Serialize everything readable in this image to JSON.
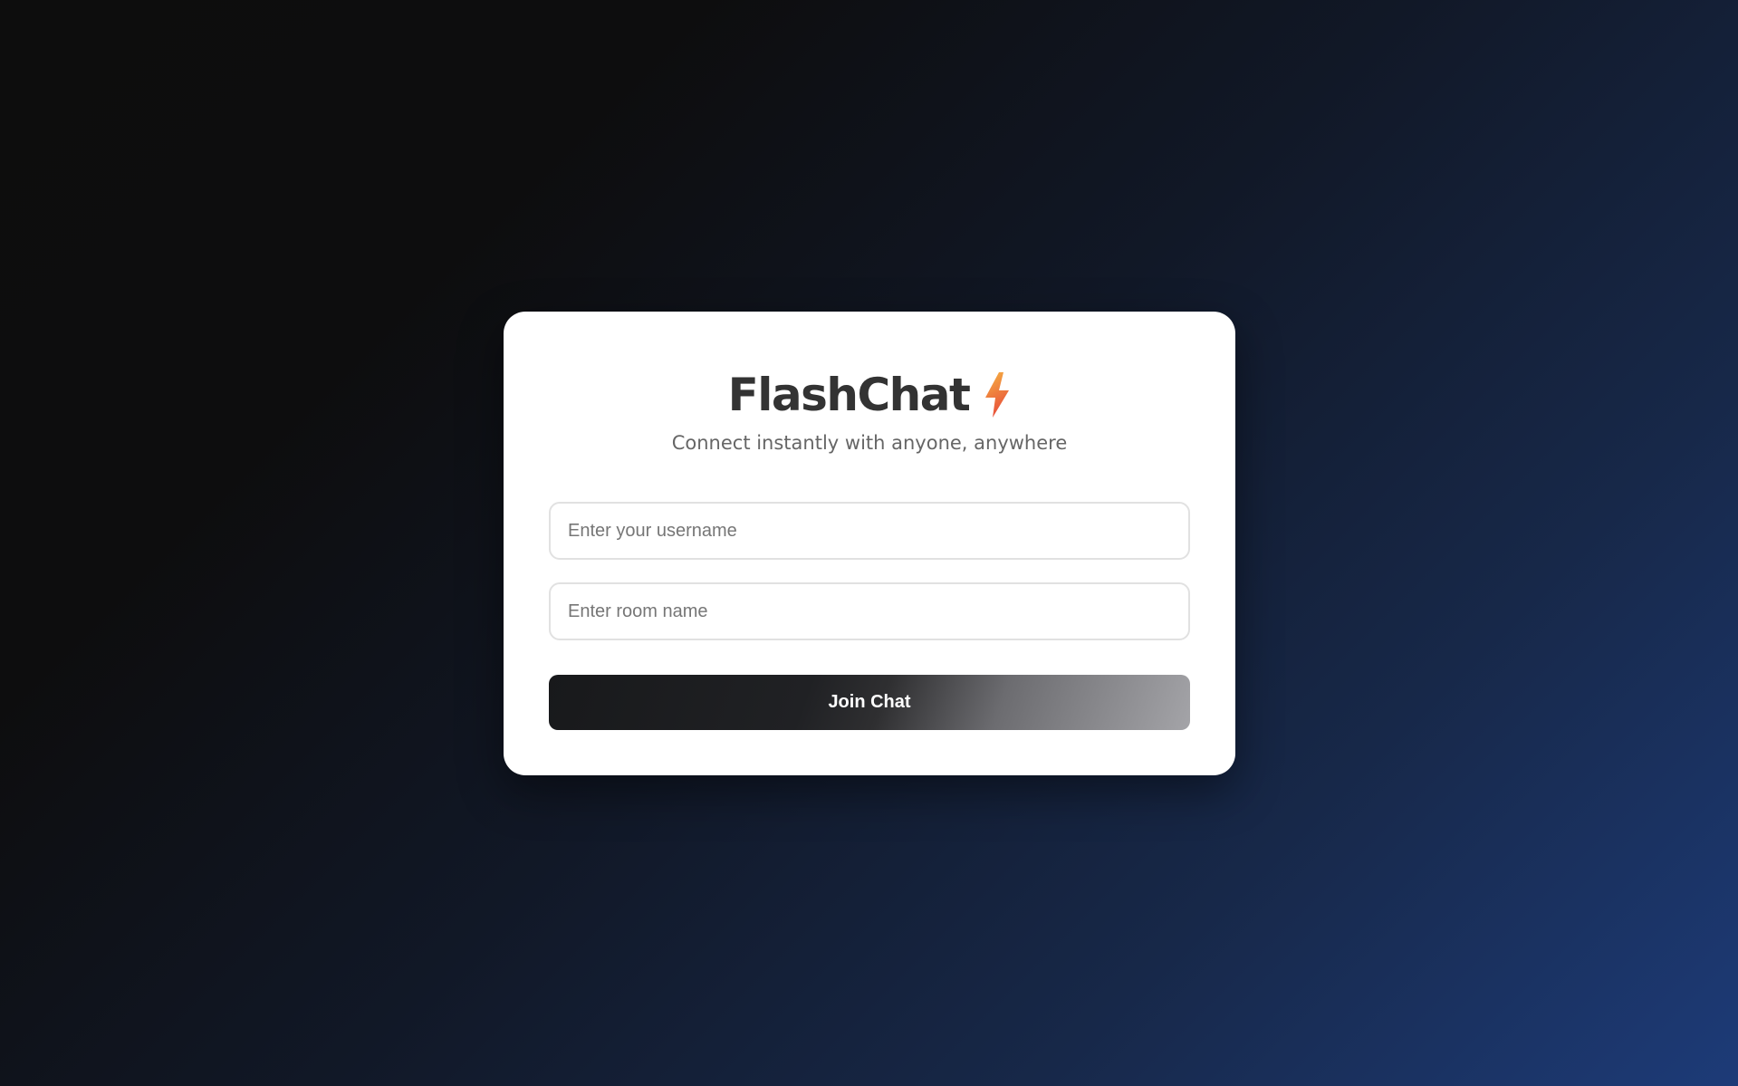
{
  "login_card": {
    "title": "FlashChat",
    "title_icon": "lightning-bolt-icon",
    "subtitle": "Connect instantly with anyone, anywhere",
    "username_input": {
      "placeholder": "Enter your username",
      "value": ""
    },
    "room_input": {
      "placeholder": "Enter room name",
      "value": ""
    },
    "join_button_label": "Join Chat"
  },
  "colors": {
    "background_start": "#0d0d0d",
    "background_end": "#1d3b78",
    "card": "#ffffff",
    "title_text": "#333333",
    "subtitle_text": "#666666",
    "bolt_top": "#f6b343",
    "bolt_bottom": "#e8503a",
    "button_dark": "#18191b",
    "button_light": "#a4a4a8"
  }
}
